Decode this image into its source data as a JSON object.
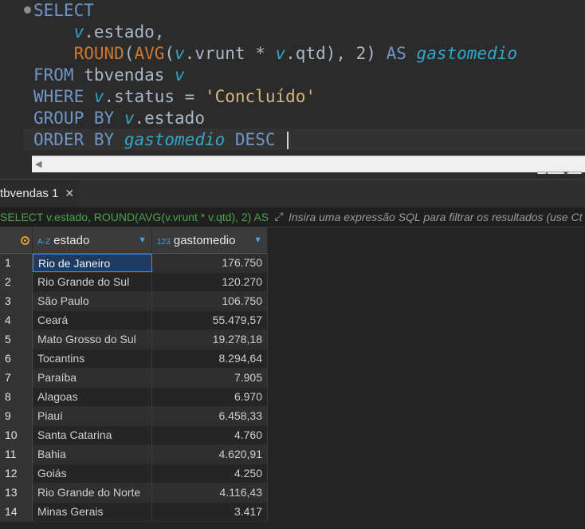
{
  "editor": {
    "lines": [
      {
        "parts": [
          [
            "kw",
            "SELECT"
          ]
        ]
      },
      {
        "parts": [
          [
            "op",
            "    "
          ],
          [
            "ital",
            "v"
          ],
          [
            "op",
            ".estado,"
          ]
        ]
      },
      {
        "parts": [
          [
            "op",
            "    "
          ],
          [
            "fn",
            "ROUND"
          ],
          [
            "op",
            "("
          ],
          [
            "fn",
            "AVG"
          ],
          [
            "op",
            "("
          ],
          [
            "ital",
            "v"
          ],
          [
            "op",
            ".vrunt * "
          ],
          [
            "ital",
            "v"
          ],
          [
            "op",
            ".qtd), 2) "
          ],
          [
            "kw",
            "AS"
          ],
          [
            "op",
            " "
          ],
          [
            "ital",
            "gastomedio"
          ]
        ]
      },
      {
        "parts": [
          [
            "kw",
            "FROM"
          ],
          [
            "op",
            " tbvendas "
          ],
          [
            "ital",
            "v"
          ]
        ]
      },
      {
        "parts": [
          [
            "kw",
            "WHERE"
          ],
          [
            "op",
            " "
          ],
          [
            "ital",
            "v"
          ],
          [
            "op",
            ".status = "
          ],
          [
            "str",
            "'Concluído'"
          ]
        ]
      },
      {
        "parts": [
          [
            "kw",
            "GROUP BY"
          ],
          [
            "op",
            " "
          ],
          [
            "ital",
            "v"
          ],
          [
            "op",
            ".estado"
          ]
        ]
      },
      {
        "parts": [
          [
            "kw",
            "ORDER BY"
          ],
          [
            "op",
            " "
          ],
          [
            "ital",
            "gastomedio"
          ],
          [
            "op",
            " "
          ],
          [
            "kw",
            "DESC"
          ]
        ]
      }
    ]
  },
  "results_tab": {
    "label": "tbvendas 1",
    "close_symbol": "✕"
  },
  "filter": {
    "sql_preview": "SELECT v.estado, ROUND(AVG(v.vrunt * v.qtd), 2) AS",
    "placeholder": "Insira uma expressão SQL para filtrar os resultados (use Ct"
  },
  "grid": {
    "columns": [
      {
        "type_badge": "A-Z",
        "label": "estado"
      },
      {
        "type_badge": "123",
        "label": "gastomedio"
      }
    ],
    "rows": [
      {
        "n": "1",
        "estado": "Rio de Janeiro",
        "gastomedio": "176.750"
      },
      {
        "n": "2",
        "estado": "Rio Grande do Sul",
        "gastomedio": "120.270"
      },
      {
        "n": "3",
        "estado": "São Paulo",
        "gastomedio": "106.750"
      },
      {
        "n": "4",
        "estado": "Ceará",
        "gastomedio": "55.479,57"
      },
      {
        "n": "5",
        "estado": "Mato Grosso do Sul",
        "gastomedio": "19.278,18"
      },
      {
        "n": "6",
        "estado": "Tocantins",
        "gastomedio": "8.294,64"
      },
      {
        "n": "7",
        "estado": "Paraíba",
        "gastomedio": "7.905"
      },
      {
        "n": "8",
        "estado": "Alagoas",
        "gastomedio": "6.970"
      },
      {
        "n": "9",
        "estado": "Piauí",
        "gastomedio": "6.458,33"
      },
      {
        "n": "10",
        "estado": "Santa Catarina",
        "gastomedio": "4.760"
      },
      {
        "n": "11",
        "estado": "Bahia",
        "gastomedio": "4.620,91"
      },
      {
        "n": "12",
        "estado": "Goiás",
        "gastomedio": "4.250"
      },
      {
        "n": "13",
        "estado": "Rio Grande do Norte",
        "gastomedio": "4.116,43"
      },
      {
        "n": "14",
        "estado": "Minas Gerais",
        "gastomedio": "3.417"
      }
    ]
  }
}
